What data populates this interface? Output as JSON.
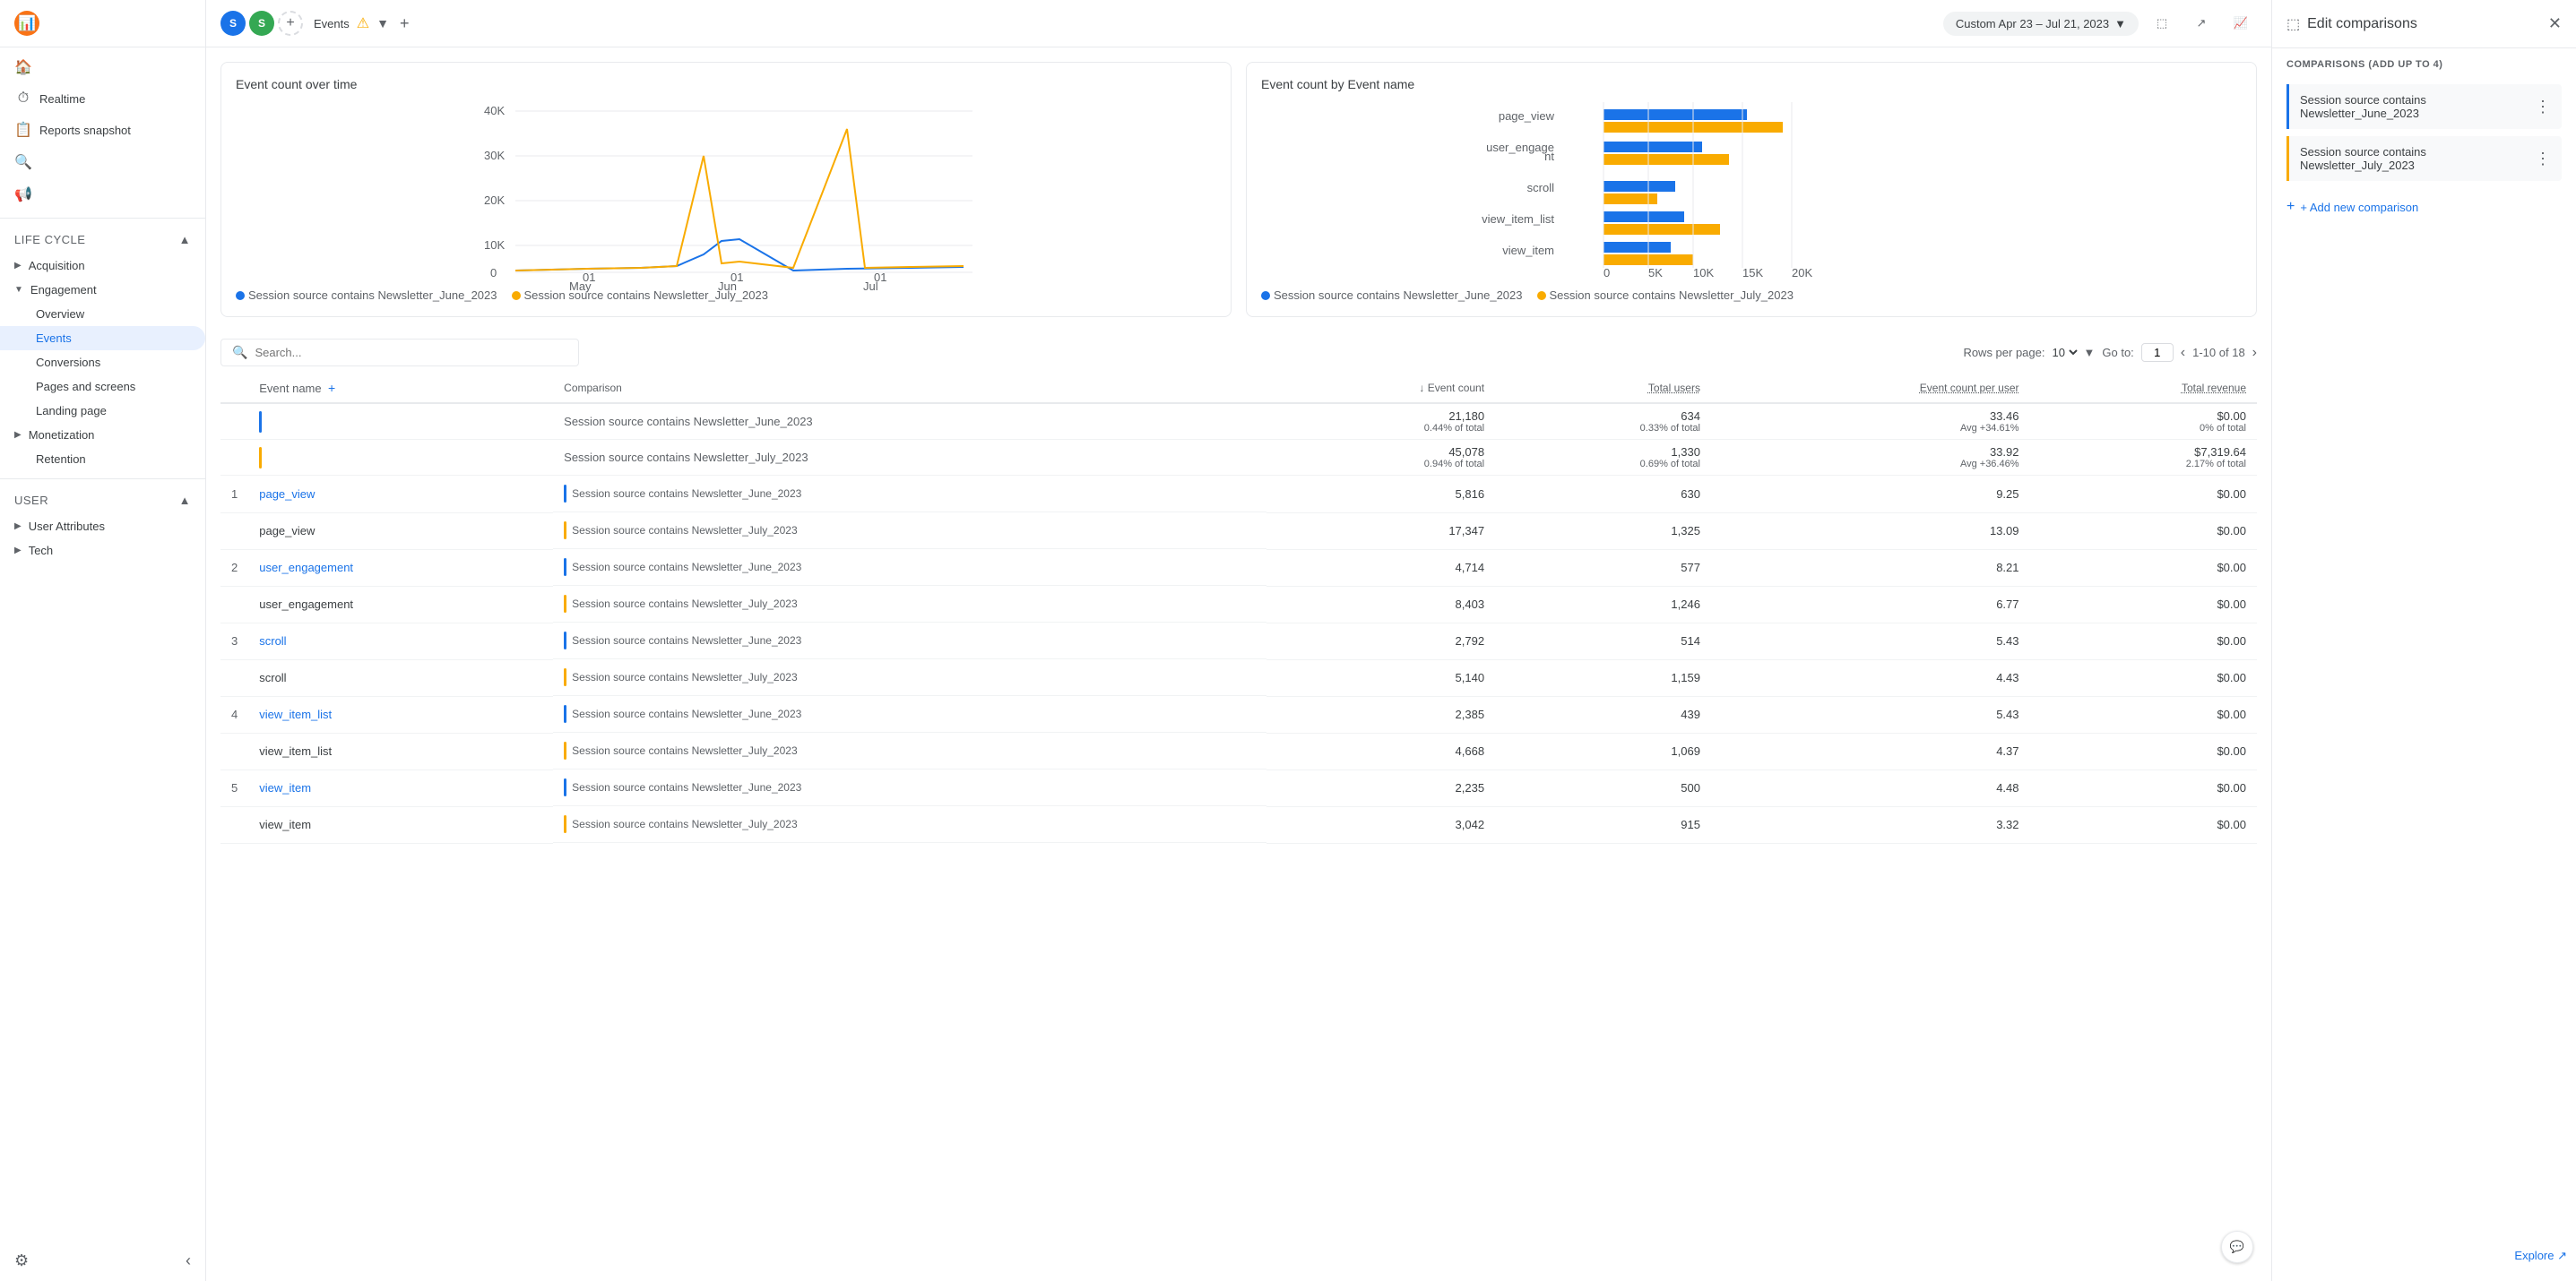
{
  "nav": {
    "logo_label": "Analytics",
    "home_icon": "🏠",
    "realtime_label": "Realtime",
    "lifecycle_label": "Life cycle",
    "acquisition_label": "Acquisition",
    "engagement_label": "Engagement",
    "overview_label": "Overview",
    "events_label": "Events",
    "conversions_label": "Conversions",
    "pages_label": "Pages and screens",
    "landing_label": "Landing page",
    "monetization_label": "Monetization",
    "retention_label": "Retention",
    "user_label": "User",
    "user_attributes_label": "User Attributes",
    "tech_label": "Tech",
    "settings_icon": "⚙",
    "collapse_icon": "‹"
  },
  "topbar": {
    "title": "Events",
    "date_label": "Custom  Apr 23 – Jul 21, 2023",
    "add_icon": "+",
    "warning_icon": "⚠"
  },
  "page_breadcrumb": "Reports snapshot",
  "charts": {
    "left_title": "Event count over time",
    "right_title": "Event count by Event name",
    "legend": {
      "june": "Session source contains Newsletter_June_2023",
      "july": "Session source contains Newsletter_July_2023"
    },
    "bar_data": [
      {
        "label": "page_view",
        "june": 80,
        "july": 100
      },
      {
        "label": "user_engagement",
        "june": 55,
        "july": 70
      },
      {
        "label": "scroll",
        "june": 40,
        "july": 30
      },
      {
        "label": "view_item_list",
        "june": 45,
        "july": 65
      },
      {
        "label": "view_item",
        "june": 38,
        "july": 50
      }
    ],
    "bar_x_labels": [
      "0",
      "5K",
      "10K",
      "15K",
      "20K"
    ],
    "line_y_labels": [
      "40K",
      "30K",
      "20K",
      "10K",
      "0"
    ],
    "line_x_labels": [
      "01 May",
      "01 Jun",
      "01 Jul"
    ]
  },
  "table": {
    "search_placeholder": "Search...",
    "rows_per_page_label": "Rows per page:",
    "rows_per_page_value": "10",
    "go_to_label": "Go to:",
    "go_to_value": "1",
    "pagination_text": "1-10 of 18",
    "columns": [
      {
        "label": "Event name",
        "key": "event_name",
        "align": "left"
      },
      {
        "label": "Comparison",
        "key": "comparison",
        "align": "left"
      },
      {
        "label": "↓ Event count",
        "key": "event_count",
        "align": "right"
      },
      {
        "label": "Total users",
        "key": "total_users",
        "align": "right",
        "underline": true
      },
      {
        "label": "Event count per user",
        "key": "event_per_user",
        "align": "right",
        "underline": true
      },
      {
        "label": "Total revenue",
        "key": "total_revenue",
        "align": "right",
        "underline": true
      }
    ],
    "summary_rows": [
      {
        "indicator": "blue",
        "comparison": "Session source contains Newsletter_June_2023",
        "event_count": "21,180",
        "event_count_sub": "0.44% of total",
        "total_users": "634",
        "total_users_sub": "0.33% of total",
        "event_per_user": "33.46",
        "event_per_user_sub": "Avg +34.61%",
        "total_revenue": "$0.00",
        "total_revenue_sub": "0% of total"
      },
      {
        "indicator": "orange",
        "comparison": "Session source contains Newsletter_July_2023",
        "event_count": "45,078",
        "event_count_sub": "0.94% of total",
        "total_users": "1,330",
        "total_users_sub": "0.69% of total",
        "event_per_user": "33.92",
        "event_per_user_sub": "Avg +36.46%",
        "total_revenue": "$7,319.64",
        "total_revenue_sub": "2.17% of total"
      }
    ],
    "data_rows": [
      {
        "num": "1",
        "event_name": "page_view",
        "is_link": true,
        "rows": [
          {
            "indicator": "blue",
            "comparison": "Session source contains Newsletter_June_2023",
            "event_count": "5,816",
            "total_users": "630",
            "event_per_user": "9.25",
            "total_revenue": "$0.00"
          },
          {
            "indicator": "orange",
            "comparison": "Session source contains Newsletter_July_2023",
            "event_count": "17,347",
            "total_users": "1,325",
            "event_per_user": "13.09",
            "total_revenue": "$0.00"
          }
        ]
      },
      {
        "num": "2",
        "event_name": "user_engagement",
        "is_link": true,
        "rows": [
          {
            "indicator": "blue",
            "comparison": "Session source contains Newsletter_June_2023",
            "event_count": "4,714",
            "total_users": "577",
            "event_per_user": "8.21",
            "total_revenue": "$0.00"
          },
          {
            "indicator": "orange",
            "comparison": "Session source contains Newsletter_July_2023",
            "event_count": "8,403",
            "total_users": "1,246",
            "event_per_user": "6.77",
            "total_revenue": "$0.00"
          }
        ]
      },
      {
        "num": "3",
        "event_name": "scroll",
        "is_link": true,
        "rows": [
          {
            "indicator": "blue",
            "comparison": "Session source contains Newsletter_June_2023",
            "event_count": "2,792",
            "total_users": "514",
            "event_per_user": "5.43",
            "total_revenue": "$0.00"
          },
          {
            "indicator": "orange",
            "comparison": "Session source contains Newsletter_July_2023",
            "event_count": "5,140",
            "total_users": "1,159",
            "event_per_user": "4.43",
            "total_revenue": "$0.00"
          }
        ]
      },
      {
        "num": "4",
        "event_name": "view_item_list",
        "is_link": true,
        "rows": [
          {
            "indicator": "blue",
            "comparison": "Session source contains Newsletter_June_2023",
            "event_count": "2,385",
            "total_users": "439",
            "event_per_user": "5.43",
            "total_revenue": "$0.00"
          },
          {
            "indicator": "orange",
            "comparison": "Session source contains Newsletter_July_2023",
            "event_count": "4,668",
            "total_users": "1,069",
            "event_per_user": "4.37",
            "total_revenue": "$0.00"
          }
        ]
      },
      {
        "num": "5",
        "event_name": "view_item",
        "is_link": true,
        "rows": [
          {
            "indicator": "blue",
            "comparison": "Session source contains Newsletter_June_2023",
            "event_count": "2,235",
            "total_users": "500",
            "event_per_user": "4.48",
            "total_revenue": "$0.00"
          },
          {
            "indicator": "orange",
            "comparison": "Session source contains Newsletter_July_2023",
            "event_count": "3,042",
            "total_users": "915",
            "event_per_user": "3.32",
            "total_revenue": "$0.00"
          }
        ]
      }
    ]
  },
  "right_panel": {
    "title": "Edit comparisons",
    "comparisons_label": "COMPARISONS (ADD UP TO 4)",
    "items": [
      {
        "color": "blue",
        "text": "Session source contains Newsletter_June_2023"
      },
      {
        "color": "orange",
        "text": "Session source contains Newsletter_July_2023"
      }
    ],
    "add_label": "+ Add new comparison"
  },
  "explore_label": "Explore ↗",
  "chat_icon": "💬"
}
